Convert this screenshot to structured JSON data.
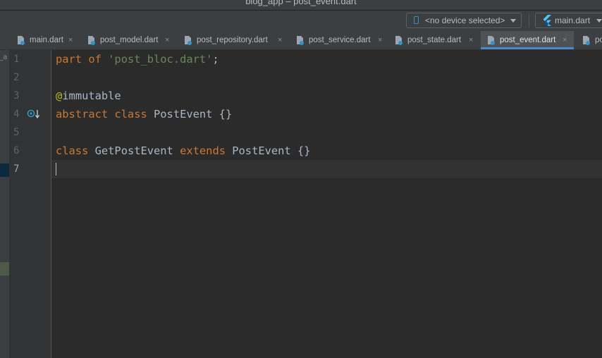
{
  "window": {
    "title": "blog_app – post_event.dart"
  },
  "toolbar": {
    "device_select": "<no device selected>",
    "run_config": "main.dart"
  },
  "tabs": [
    {
      "label": "main.dart",
      "active": false
    },
    {
      "label": "post_model.dart",
      "active": false
    },
    {
      "label": "post_repository.dart",
      "active": false
    },
    {
      "label": "post_service.dart",
      "active": false
    },
    {
      "label": "post_state.dart",
      "active": false
    },
    {
      "label": "post_event.dart",
      "active": true
    },
    {
      "label": "po",
      "active": false
    }
  ],
  "tab_close_glyph": "×",
  "left_strip": {
    "cut_label": "_a"
  },
  "editor": {
    "current_line": 7,
    "line_numbers": [
      "1",
      "2",
      "3",
      "4",
      "5",
      "6",
      "7"
    ],
    "lines": [
      {
        "k1": "part of",
        "s1": "'post_bloc.dart'",
        "p1": ";"
      },
      {},
      {
        "a1": "@",
        "p1": "immutable"
      },
      {
        "k1": "abstract class",
        "p1": "PostEvent {}"
      },
      {},
      {
        "k1": "class",
        "p1": "GetPostEvent",
        "k2": "extends",
        "p2": "PostEvent {}"
      },
      {}
    ]
  },
  "colors": {
    "keyword": "#cc7832",
    "string": "#6a8759",
    "annotation": "#bbb529",
    "text": "#a9b7c6",
    "accent": "#4a88c7"
  },
  "icons": {
    "device": "phone-icon",
    "run_config": "flutter-icon",
    "tab_file": "dart-file-icon",
    "gutter": "implemented-by-icon"
  }
}
